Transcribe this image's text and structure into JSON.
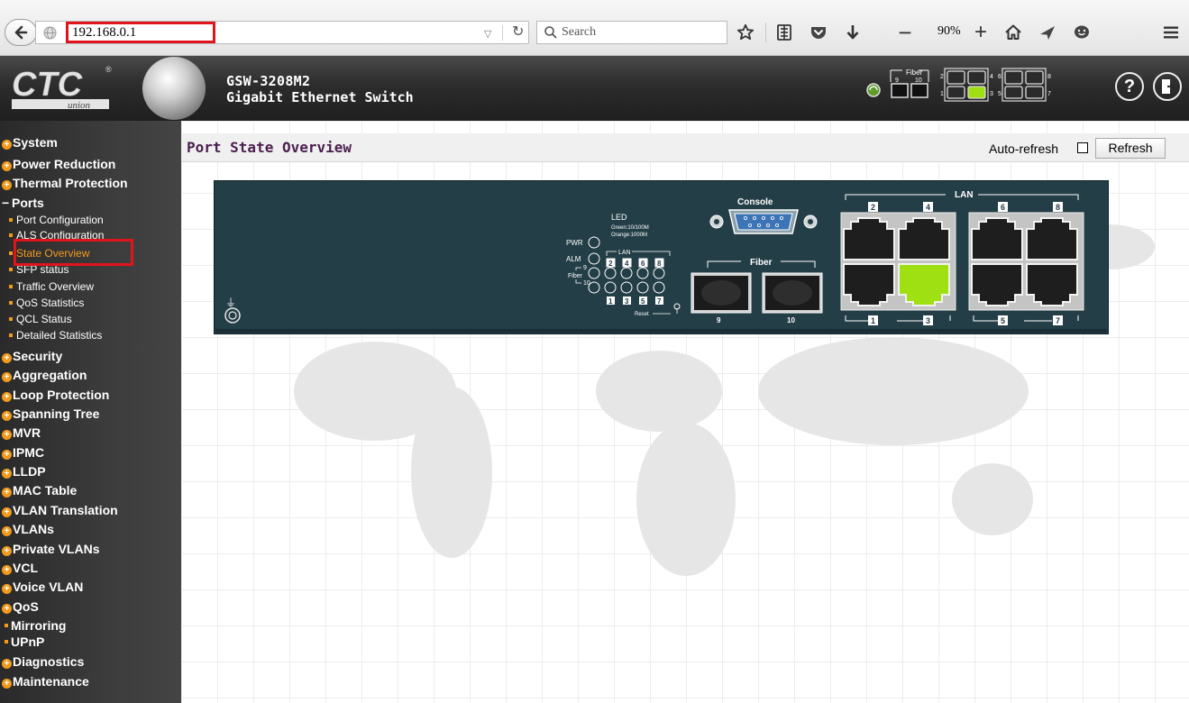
{
  "browser": {
    "url": "192.168.0.1",
    "search_placeholder": "Search",
    "zoom": "90%",
    "icons": [
      "back-arrow-icon",
      "globe-icon",
      "dropdown-icon",
      "reload-icon",
      "search-icon",
      "star-icon",
      "reader-icon",
      "pocket-icon",
      "download-icon",
      "zoom-out-icon",
      "zoom-in-icon",
      "home-icon",
      "send-icon",
      "chat-icon",
      "menu-icon"
    ]
  },
  "header": {
    "model": "GSW-3208M2",
    "description": "Gigabit Ethernet Switch",
    "fiber_label": "Fiber",
    "fiber_ports": [
      "9",
      "10"
    ],
    "lan_ports_top": [
      "2",
      "4",
      "6",
      "8"
    ],
    "lan_ports_bottom": [
      "1",
      "3",
      "5",
      "7"
    ]
  },
  "sidebar": {
    "items": [
      {
        "label": "System",
        "kind": "plus"
      },
      {
        "label": "Power Reduction",
        "kind": "plus"
      },
      {
        "label": "Thermal Protection",
        "kind": "plus"
      },
      {
        "label": "Ports",
        "kind": "minus"
      },
      {
        "label": "Port Configuration",
        "kind": "sub"
      },
      {
        "label": "ALS Configuration",
        "kind": "sub"
      },
      {
        "label": "State Overview",
        "kind": "sub",
        "active": true
      },
      {
        "label": "SFP status",
        "kind": "sub"
      },
      {
        "label": "Traffic Overview",
        "kind": "sub"
      },
      {
        "label": "QoS Statistics",
        "kind": "sub"
      },
      {
        "label": "QCL Status",
        "kind": "sub"
      },
      {
        "label": "Detailed Statistics",
        "kind": "sub"
      },
      {
        "label": "Security",
        "kind": "plus"
      },
      {
        "label": "Aggregation",
        "kind": "plus"
      },
      {
        "label": "Loop Protection",
        "kind": "plus"
      },
      {
        "label": "Spanning Tree",
        "kind": "plus"
      },
      {
        "label": "MVR",
        "kind": "plus"
      },
      {
        "label": "IPMC",
        "kind": "plus"
      },
      {
        "label": "LLDP",
        "kind": "plus"
      },
      {
        "label": "MAC Table",
        "kind": "plus"
      },
      {
        "label": "VLAN Translation",
        "kind": "plus"
      },
      {
        "label": "VLANs",
        "kind": "plus"
      },
      {
        "label": "Private VLANs",
        "kind": "plus"
      },
      {
        "label": "VCL",
        "kind": "plus"
      },
      {
        "label": "Voice VLAN",
        "kind": "plus"
      },
      {
        "label": "QoS",
        "kind": "plus"
      },
      {
        "label": "Mirroring",
        "kind": "bullet"
      },
      {
        "label": "UPnP",
        "kind": "bullet"
      },
      {
        "label": "Diagnostics",
        "kind": "plus"
      },
      {
        "label": "Maintenance",
        "kind": "plus"
      }
    ]
  },
  "main": {
    "title": "Port State Overview",
    "auto_refresh_label": "Auto-refresh",
    "auto_refresh_checked": false,
    "refresh_label": "Refresh"
  },
  "device": {
    "console_label": "Console",
    "lan_label": "LAN",
    "fiber_label": "Fiber",
    "led_title": "LED",
    "led_green": "Green:10/100M",
    "led_orange": "Orange:1000M",
    "pwr_label": "PWR",
    "alm_label": "ALM",
    "led_lan_label": "LAN",
    "led_fiber_label": "Fiber",
    "led_9": "9",
    "led_10": "10",
    "led_top_nums": [
      "2",
      "4",
      "6",
      "8"
    ],
    "led_bottom_nums": [
      "1",
      "3",
      "5",
      "7"
    ],
    "reset_label": "Reset",
    "fiber_ports": [
      "9",
      "10"
    ],
    "lan_top": [
      "2",
      "4",
      "6",
      "8"
    ],
    "lan_bottom": [
      "1",
      "3",
      "5",
      "7"
    ],
    "active_port": "3",
    "active_color": "#9ee011"
  }
}
